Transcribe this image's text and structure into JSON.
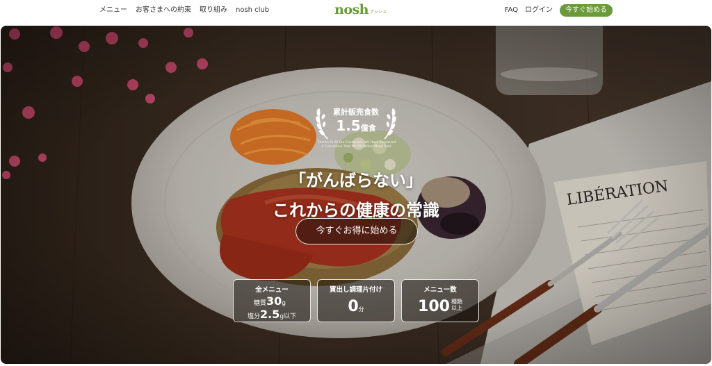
{
  "header": {
    "nav_left": [
      "メニュー",
      "お客さまへの約束",
      "取り組み",
      "nosh club"
    ],
    "logo": {
      "word": "nosh",
      "kana": "ナッシュ"
    },
    "faq": "FAQ",
    "login": "ログイン",
    "cta": "今すぐ始める"
  },
  "hero": {
    "badge_label": "累計販売食数",
    "badge_number": "1.5",
    "badge_unit": "億食",
    "thanks_line1": "Thanks To All Our Customers, We Have Surpassed",
    "thanks_line2": "A Cumulative Total Of 150 Million Meals Sold.",
    "headline_line1": "「がんばらない」",
    "headline_line2": "これからの健康の常識",
    "cta": "今すぐお得に始める",
    "newspaper_text": "LIBÉRATION"
  },
  "stats": {
    "all_menu": {
      "title": "全メニュー",
      "carb_label": "糖質",
      "carb_value": "30",
      "carb_unit": "g",
      "salt_label": "塩分",
      "salt_value": "2.5",
      "salt_unit": "g以下"
    },
    "no_cooking": {
      "title": "買出し調理片付け",
      "value": "0",
      "unit": "分"
    },
    "menu_count": {
      "title": "メニュー数",
      "value": "100",
      "unit_line1": "種類",
      "unit_line2": "以上"
    }
  },
  "colors": {
    "brand_green": "#6a9a3a",
    "hero_bg": "#3a2c22"
  }
}
